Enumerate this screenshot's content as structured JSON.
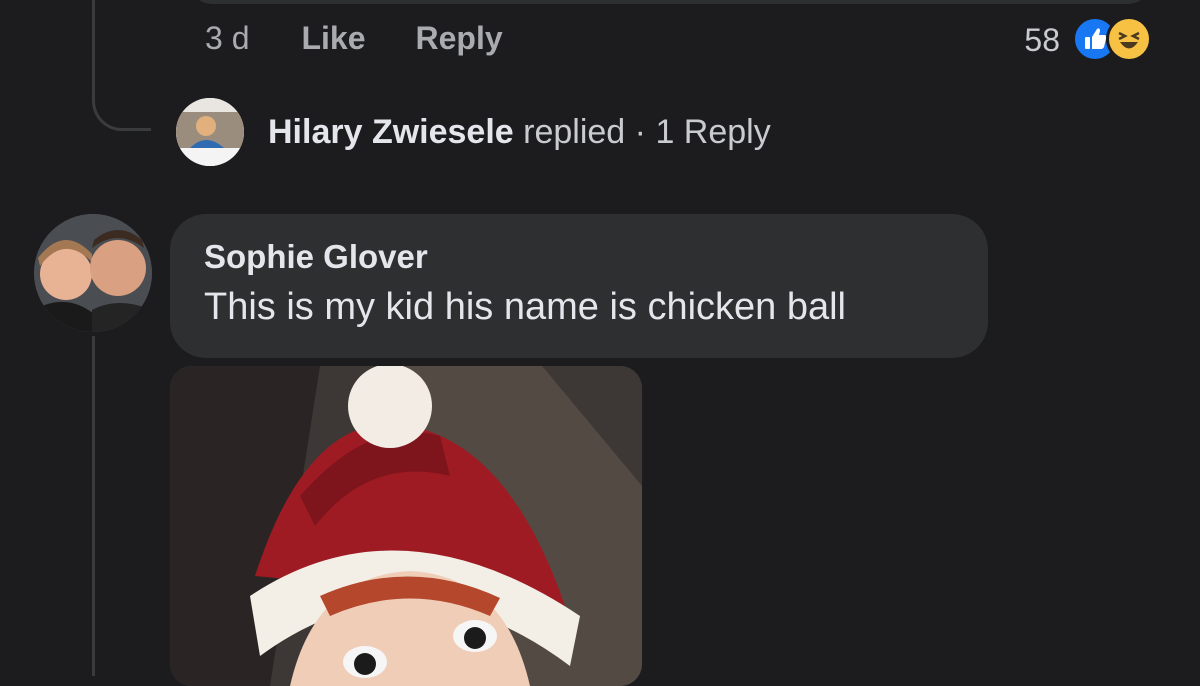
{
  "comment_meta": {
    "time": "3 d",
    "like_label": "Like",
    "reply_label": "Reply",
    "reaction_count": "58",
    "reactions": [
      "like-icon",
      "haha-icon"
    ]
  },
  "reply_summary": {
    "name": "Hilary Zwiesele",
    "verb": "replied",
    "separator": "·",
    "count_label": "1 Reply"
  },
  "comment": {
    "author": "Sophie Glover",
    "text": "This is my kid his name is chicken ball"
  },
  "colors": {
    "background": "#1c1c1e",
    "bubble": "#2e2f31",
    "like_blue": "#1877f2",
    "haha_yellow": "#f7c244"
  }
}
